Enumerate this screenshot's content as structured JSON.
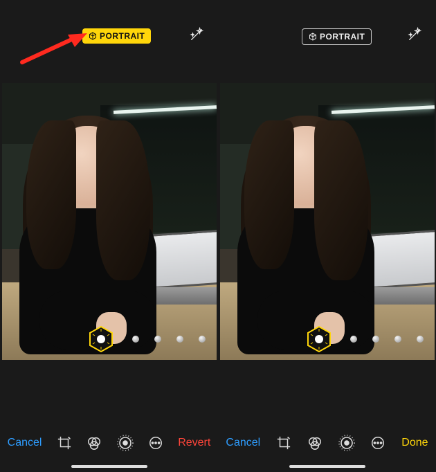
{
  "top": {
    "left_badge": "PORTRAIT",
    "right_badge": "PORTRAIT",
    "badge_active_bg": "#ffd60a",
    "badge_active_fg": "#111111",
    "badge_inactive_fg": "#eeeeee"
  },
  "lighting_modes": {
    "selected_index": 0,
    "selected_icon": "studio-light-hexagon",
    "option_count": 5
  },
  "toolbar": {
    "left": {
      "cancel": "Cancel",
      "crop_icon": "crop",
      "filters_icon": "filters",
      "adjust_icon": "adjust",
      "more_icon": "more",
      "primary": "Revert",
      "primary_color": "#ff453a"
    },
    "right": {
      "cancel": "Cancel",
      "crop_icon": "crop",
      "filters_icon": "filters",
      "adjust_icon": "adjust",
      "more_icon": "more",
      "primary": "Done",
      "primary_color": "#ffd60a"
    }
  },
  "annotation": {
    "arrow_color": "#ff2a1f",
    "arrow_points_to": "portrait-badge-active"
  }
}
